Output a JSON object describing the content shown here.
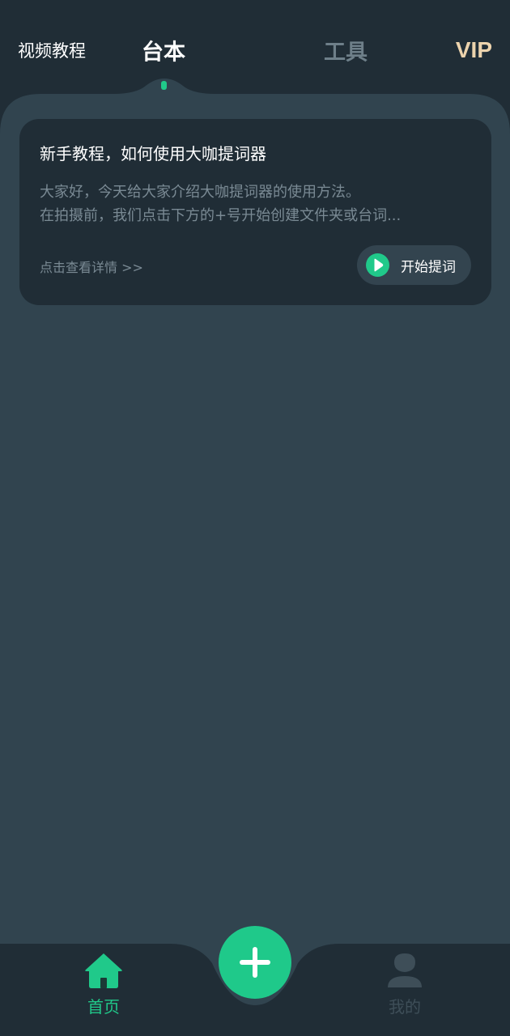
{
  "top_tabs": {
    "video_tutorial": "视频教程",
    "script": "台本",
    "tools": "工具",
    "vip": "VIP"
  },
  "card": {
    "title": "新手教程，如何使用大咖提词器",
    "description": "大家好，今天给大家介绍大咖提词器的使用方法。\n 在拍摄前，我们点击下方的+号开始创建文件夹或台词...",
    "detail_link": "点击查看详情 >>",
    "start_button": "开始提词"
  },
  "bottom_nav": {
    "home": "首页",
    "mine": "我的"
  },
  "colors": {
    "accent": "#20c98a",
    "background": "#202d36",
    "panel": "#31444f",
    "vip": "#ecd3ad"
  }
}
